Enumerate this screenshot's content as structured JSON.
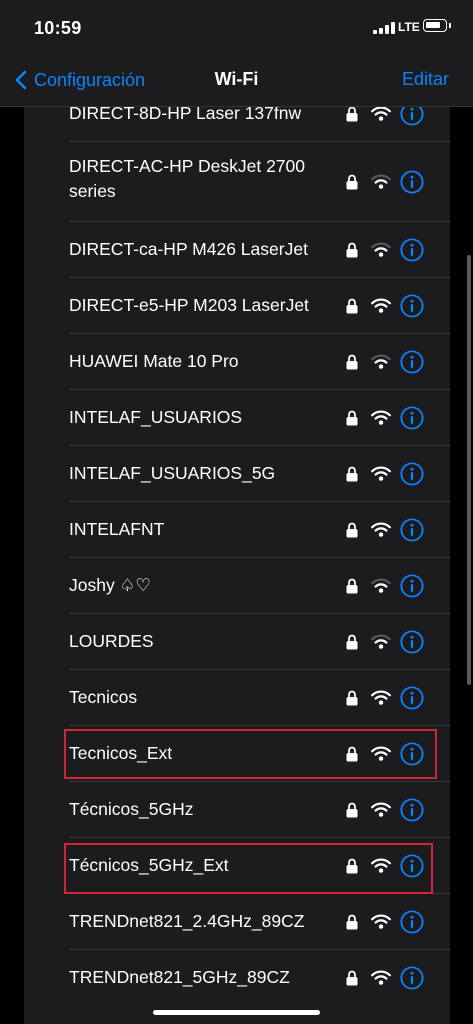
{
  "status_bar": {
    "time": "10:59",
    "network": "LTE",
    "signal_bars": 4,
    "battery_level": 0.8
  },
  "nav": {
    "back_label": "Configuración",
    "title": "Wi-Fi",
    "edit_label": "Editar",
    "accent_color": "#0a84ff"
  },
  "networks": [
    {
      "name": "DIRECT-8D-HP Laser 137fnw",
      "secured": true,
      "signal": 3
    },
    {
      "name": "DIRECT-AC-HP DeskJet 2700 series",
      "secured": true,
      "signal": 2
    },
    {
      "name": "DIRECT-ca-HP M426 LaserJet",
      "secured": true,
      "signal": 2
    },
    {
      "name": "DIRECT-e5-HP M203 LaserJet",
      "secured": true,
      "signal": 3
    },
    {
      "name": "HUAWEI Mate 10 Pro",
      "secured": true,
      "signal": 2
    },
    {
      "name": "INTELAF_USUARIOS",
      "secured": true,
      "signal": 3
    },
    {
      "name": "INTELAF_USUARIOS_5G",
      "secured": true,
      "signal": 3
    },
    {
      "name": "INTELAFNT",
      "secured": true,
      "signal": 3
    },
    {
      "name": "Joshy ♤♡",
      "secured": true,
      "signal": 2
    },
    {
      "name": "LOURDES",
      "secured": true,
      "signal": 2
    },
    {
      "name": "Tecnicos",
      "secured": true,
      "signal": 3
    },
    {
      "name": "Tecnicos_Ext",
      "secured": true,
      "signal": 3,
      "highlighted": true
    },
    {
      "name": "Técnicos_5GHz",
      "secured": true,
      "signal": 3
    },
    {
      "name": "Técnicos_5GHz_Ext",
      "secured": true,
      "signal": 3,
      "highlighted": true
    },
    {
      "name": "TRENDnet821_2.4GHz_89CZ",
      "secured": true,
      "signal": 3
    },
    {
      "name": "TRENDnet821_5GHz_89CZ",
      "secured": true,
      "signal": 3
    }
  ],
  "highlight_color": "#d0263b",
  "icons": {
    "lock": "lock-icon",
    "wifi": "wifi-icon",
    "info": "info-icon",
    "back": "chevron-left-icon"
  }
}
